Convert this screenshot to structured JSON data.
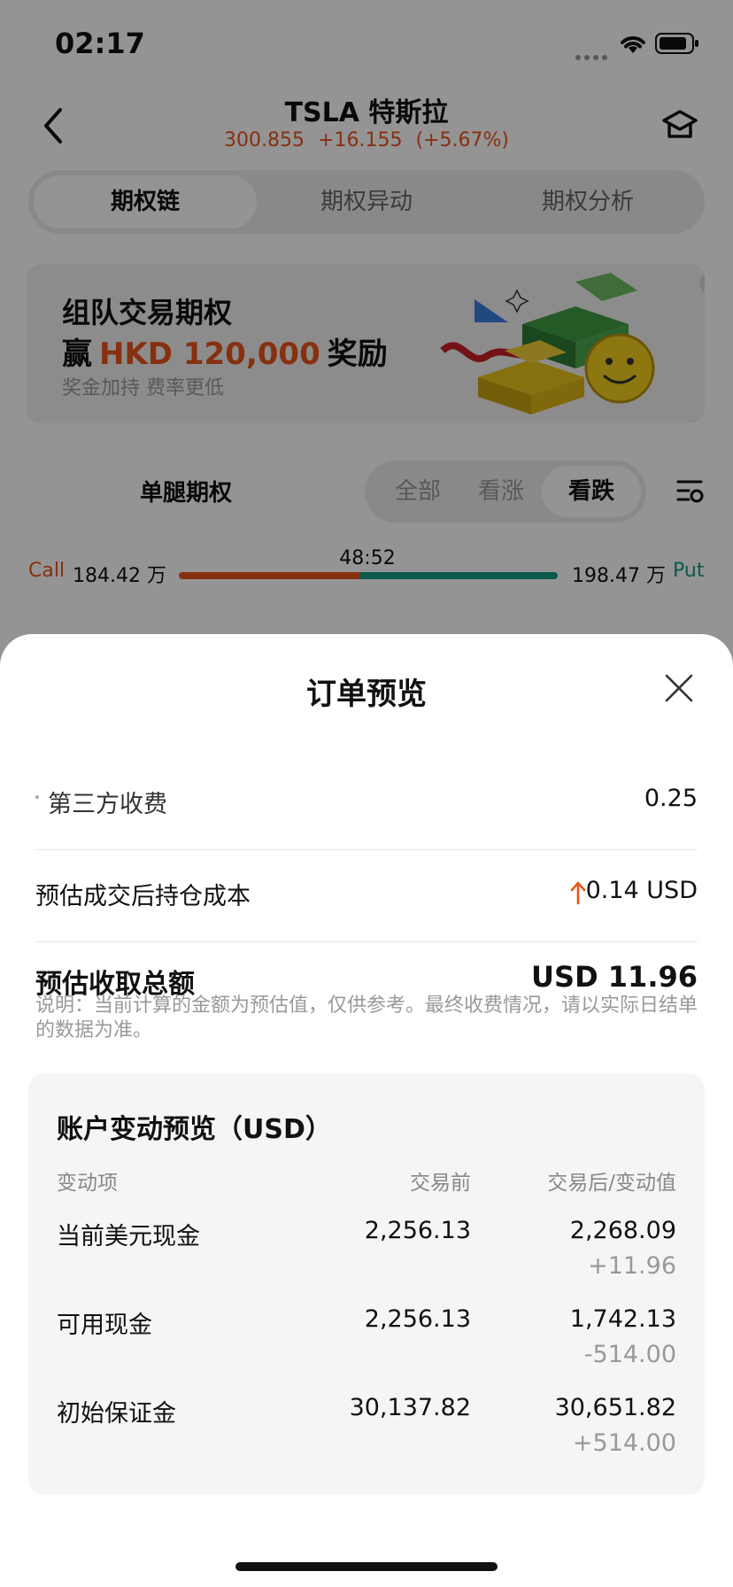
{
  "status_bar": {
    "time": "02:17"
  },
  "header": {
    "title": "TSLA 特斯拉",
    "price": "300.855",
    "change": "+16.155",
    "change_pct": "(+5.67%)"
  },
  "tabs": [
    {
      "label": "期权链",
      "active": true
    },
    {
      "label": "期权异动",
      "active": false
    },
    {
      "label": "期权分析",
      "active": false
    }
  ],
  "promo": {
    "line1": "组队交易期权",
    "line2_prefix": "赢",
    "line2_highlight": "HKD 120,000",
    "line2_suffix": "奖励",
    "subtitle": "奖金加持 费率更低"
  },
  "filter": {
    "single_leg": "单腿期权",
    "directions": [
      "全部",
      "看涨",
      "看跌"
    ],
    "active_direction": "看跌"
  },
  "call_put": {
    "call_label": "Call",
    "call_value": "184.42 万",
    "ratio": "48:52",
    "put_value": "198.47 万",
    "put_label": "Put",
    "call_fraction": 0.48
  },
  "sheet": {
    "title": "订单预览",
    "third_party_fee_label": "第三方收费",
    "third_party_fee_value": "0.25",
    "cost_label": "预估成交后持仓成本",
    "cost_value": "0.14 USD",
    "total_label": "预估收取总额",
    "total_value": "USD 11.96",
    "note": "说明：当前计算的金额为预估值，仅供参考。最终收费情况，请以实际日结单的数据为准。",
    "account": {
      "title": "账户变动预览（USD）",
      "headers": [
        "变动项",
        "交易前",
        "交易后/变动值"
      ],
      "rows": [
        {
          "name": "当前美元现金",
          "before": "2,256.13",
          "after": "2,268.09",
          "delta": "+11.96"
        },
        {
          "name": "可用现金",
          "before": "2,256.13",
          "after": "1,742.13",
          "delta": "-514.00"
        },
        {
          "name": "初始保证金",
          "before": "30,137.82",
          "after": "30,651.82",
          "delta": "+514.00"
        }
      ]
    }
  },
  "colors": {
    "up": "#e8541c",
    "down": "#129a83",
    "dim_overlay": "rgba(0,0,0,0.42)"
  }
}
